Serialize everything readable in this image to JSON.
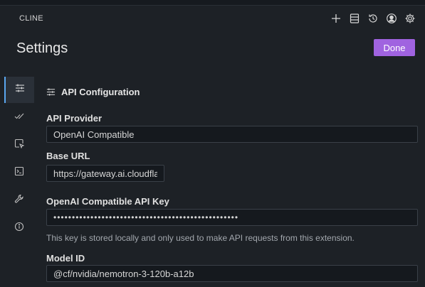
{
  "app": {
    "title": "CLINE"
  },
  "header": {
    "icons": [
      "plus-icon",
      "history-list-icon",
      "history-icon",
      "account-icon",
      "gear-icon"
    ]
  },
  "page": {
    "title": "Settings",
    "done_label": "Done"
  },
  "sidebar": {
    "tabs": [
      {
        "name": "api-configuration",
        "icon": "sliders-icon",
        "active": true
      },
      {
        "name": "features",
        "icon": "check-check-icon",
        "active": false
      },
      {
        "name": "browser",
        "icon": "browser-cursor-icon",
        "active": false
      },
      {
        "name": "terminal",
        "icon": "terminal-icon",
        "active": false
      },
      {
        "name": "debug",
        "icon": "wrench-icon",
        "active": false
      },
      {
        "name": "about",
        "icon": "info-icon",
        "active": false
      }
    ]
  },
  "api_config": {
    "section_title": "API Configuration",
    "provider_label": "API Provider",
    "provider_value": "OpenAI Compatible",
    "base_url_label": "Base URL",
    "base_url_value": "https://gateway.ai.cloudflare.com",
    "api_key_label": "OpenAI Compatible API Key",
    "api_key_value": "••••••••••••••••••••••••••••••••••••••••••••••••••",
    "api_key_help": "This key is stored locally and only used to make API requests from this extension.",
    "model_id_label": "Model ID",
    "model_id_value": "@cf/nvidia/nemotron-3-120b-a12b"
  },
  "colors": {
    "accent": "#a063e0",
    "active_tab_border": "#5aa7f0",
    "background": "#1d2126"
  }
}
